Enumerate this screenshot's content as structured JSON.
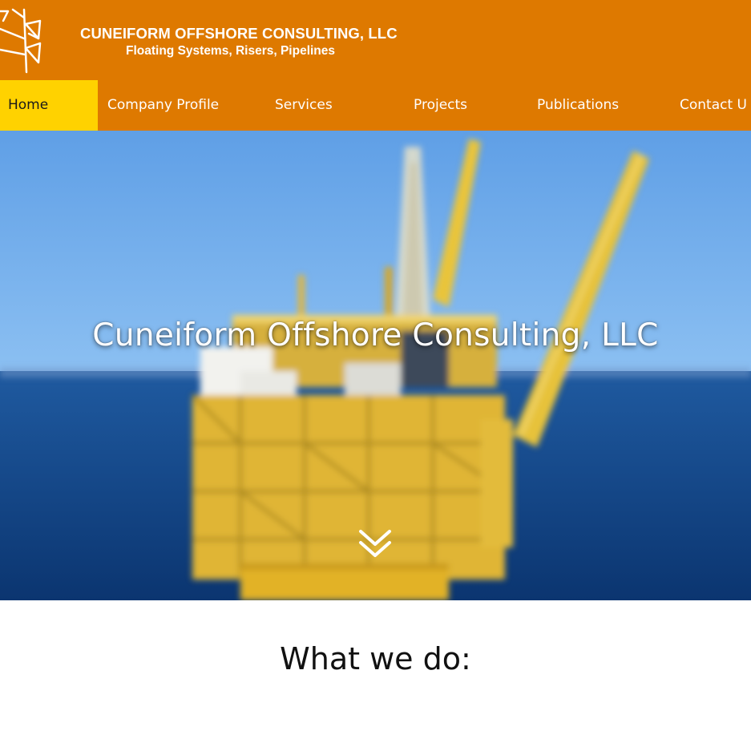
{
  "header": {
    "company_name": "CUNEIFORM OFFSHORE CONSULTING, LLC",
    "tagline": "Floating Systems, Risers, Pipelines",
    "logo_icon": "cuneiform-logo-icon",
    "background_color": "#de7900"
  },
  "nav": {
    "items": [
      {
        "label": "Home",
        "active": true
      },
      {
        "label": "Company Profile",
        "active": false
      },
      {
        "label": "Services",
        "active": false
      },
      {
        "label": "Projects",
        "active": false
      },
      {
        "label": "Publications",
        "active": false
      },
      {
        "label": "Contact U",
        "active": false
      }
    ],
    "active_color": "#ffd200",
    "background_color": "#de7900"
  },
  "hero": {
    "title": "Cuneiform Offshore Consulting, LLC",
    "background_image": "offshore-platform-photo",
    "scroll_icon": "double-chevron-down-icon"
  },
  "section": {
    "title": "What we do:"
  }
}
